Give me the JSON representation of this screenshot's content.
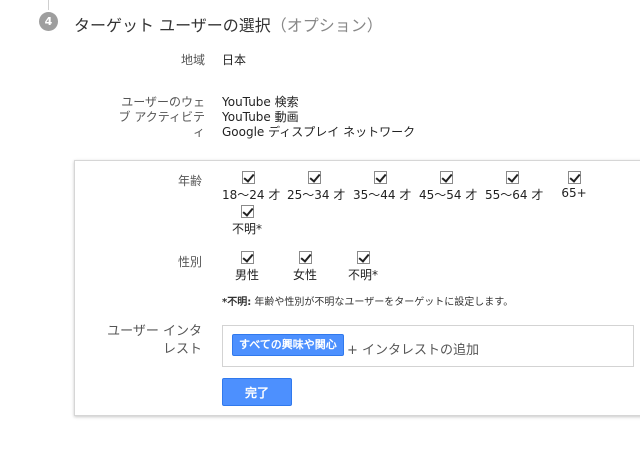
{
  "step": {
    "number": "4",
    "title": "ターゲット ユーザーの選択",
    "optional": "（オプション）"
  },
  "region": {
    "label": "地域",
    "value": "日本"
  },
  "web_activity": {
    "label_lines": [
      "ユーザーのウェ",
      "ブ アクティビテ",
      "ィ"
    ],
    "values": [
      "YouTube 検索",
      "YouTube 動画",
      "Google ディスプレイ ネットワーク"
    ]
  },
  "age": {
    "label": "年齢",
    "options": [
      {
        "label": "18～24 才",
        "checked": true
      },
      {
        "label": "25～34 才",
        "checked": true
      },
      {
        "label": "35～44 才",
        "checked": true
      },
      {
        "label": "45～54 才",
        "checked": true
      },
      {
        "label": "55～64 才",
        "checked": true
      },
      {
        "label": "65+",
        "checked": true
      },
      {
        "label": "不明*",
        "checked": true
      }
    ]
  },
  "gender": {
    "label": "性別",
    "options": [
      {
        "label": "男性",
        "checked": true
      },
      {
        "label": "女性",
        "checked": true
      },
      {
        "label": "不明*",
        "checked": true
      }
    ]
  },
  "note": {
    "prefix": "*不明:",
    "text": " 年齢や性別が不明なユーザーをターゲットに設定します。"
  },
  "interests": {
    "label_lines": [
      "ユーザー インタ",
      "レスト"
    ],
    "chip": "すべての興味や関心",
    "add_link": "+ インタレストの追加"
  },
  "done_button": "完了",
  "colors": {
    "accent": "#4d90fe",
    "accent_border": "#3079ed"
  }
}
